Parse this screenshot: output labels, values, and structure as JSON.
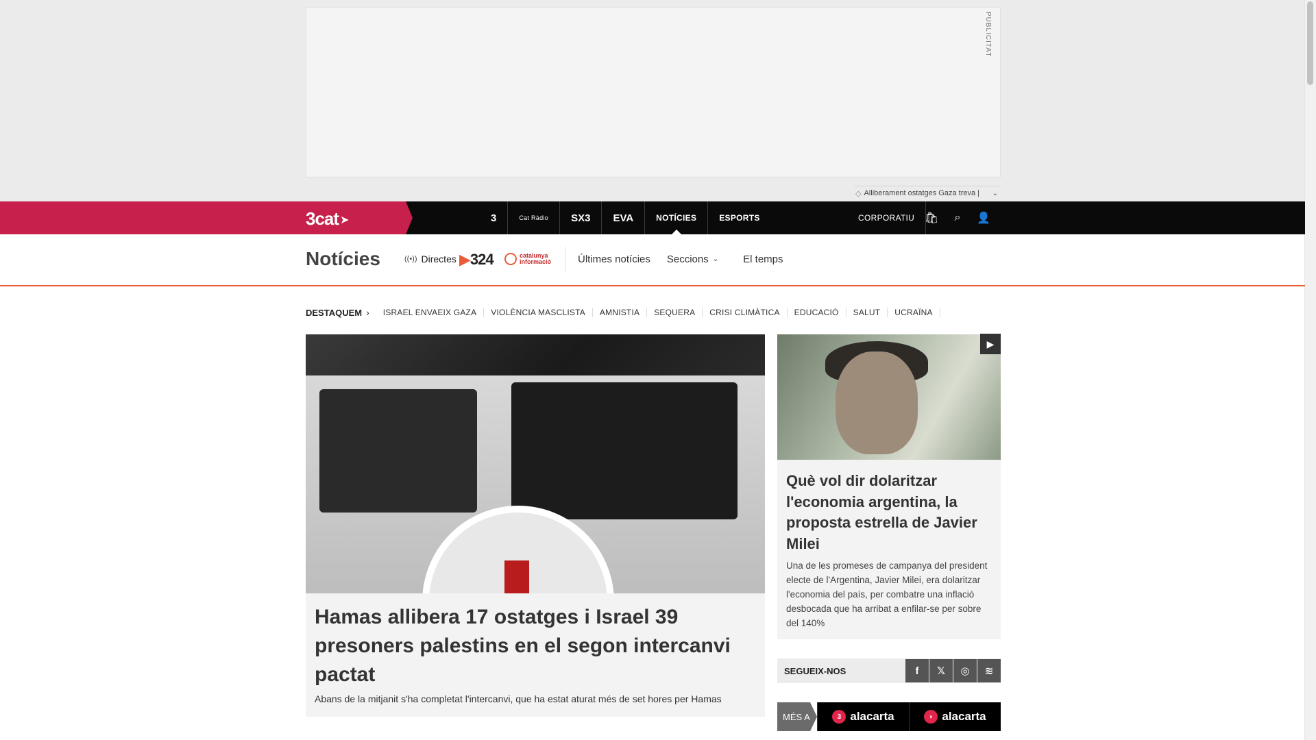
{
  "ad": {
    "label": "PUBLICITAT"
  },
  "ticker": {
    "text": "Alliberament ostatges Gaza treva |"
  },
  "nav": {
    "brand": "3cat",
    "channels": [
      {
        "label": "3"
      },
      {
        "label": "Cat Ràdio"
      },
      {
        "label": "SX3"
      },
      {
        "label": "EVA"
      },
      {
        "label": "NOTÍCIES"
      },
      {
        "label": "ESPORTS"
      }
    ],
    "corporatiu": "CORPORATIU"
  },
  "section": {
    "title": "Notícies",
    "live": "Directes",
    "logo_324": "324",
    "logo_ci": "catalunya informació",
    "links": [
      "Últimes notícies",
      "Seccions",
      "El temps"
    ]
  },
  "destaquem": {
    "lead": "DESTAQUEM",
    "topics": [
      "ISRAEL ENVAEIX GAZA",
      "VIOLÈNCIA MASCLISTA",
      "AMNISTIA",
      "SEQUERA",
      "CRISI CLIMÀTICA",
      "EDUCACIÓ",
      "SALUT",
      "UCRAÏNA"
    ]
  },
  "main_story": {
    "headline": "Hamas allibera 17 ostatges i Israel 39 presoners palestins en el segon intercanvi pactat",
    "summary": "Abans de la mitjanit s'ha completat l'intercanvi, que ha estat aturat més de set hores per Hamas"
  },
  "side_story": {
    "headline": "Què vol dir dolaritzar l'economia argentina, la proposta estrella de Javier Milei",
    "summary": "Una de les promeses de campanya del president electe de l'Argentina, Javier Milei, era dolaritzar l'economia del país, per combatre una inflació desbocada que ha arribat a enfilar-se per sobre del 140%"
  },
  "follow": {
    "label": "SEGUEIX-NOS"
  },
  "alacarta": {
    "label": "MÉS A",
    "items": [
      "alacarta",
      "alacarta"
    ]
  },
  "colors": {
    "brand": "#c8204c",
    "accent": "#e95c37",
    "nav_bg": "#0a0a0a"
  }
}
